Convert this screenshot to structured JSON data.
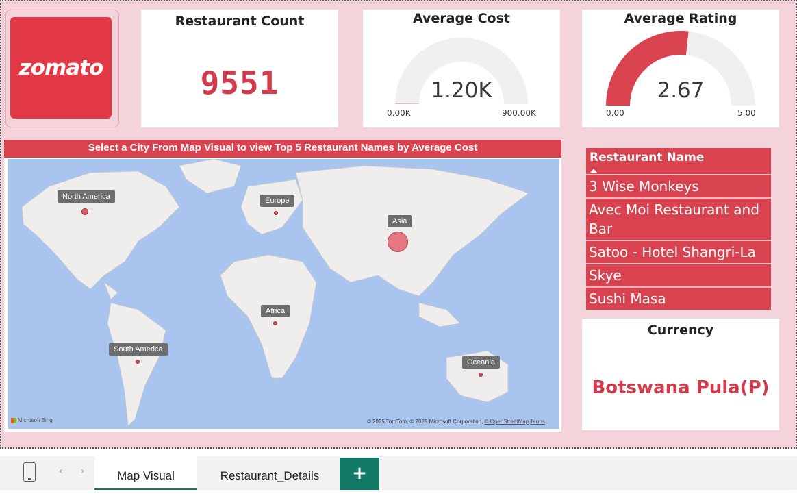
{
  "brand": {
    "logo_text": "zomato",
    "accent": "#e23744"
  },
  "kpis": {
    "restaurant_count": {
      "title": "Restaurant Count",
      "value": "9551"
    },
    "average_cost": {
      "title": "Average Cost",
      "value": "1.20K",
      "min_label": "0.00K",
      "max_label": "900.00K",
      "fill_fraction": 0.0013
    },
    "average_rating": {
      "title": "Average Rating",
      "value": "2.67",
      "min_label": "0.00",
      "max_label": "5.00",
      "fill_fraction": 0.534
    }
  },
  "map": {
    "title": "Select a City From Map Visual to view Top 5 Restaurant Names by Average Cost",
    "regions": [
      {
        "name": "North America"
      },
      {
        "name": "Europe"
      },
      {
        "name": "Asia"
      },
      {
        "name": "Africa"
      },
      {
        "name": "South America"
      },
      {
        "name": "Oceania"
      }
    ],
    "bing": "Microsoft Bing",
    "credit_prefix": "© 2025 TomTom, © 2025 Microsoft Corporation, ",
    "credit_osm": "© OpenStreetMap",
    "credit_terms": "Terms"
  },
  "restaurant_table": {
    "header": "Restaurant Name",
    "rows": [
      "3 Wise Monkeys",
      "Avec Moi Restaurant and Bar",
      "Satoo - Hotel Shangri-La",
      "Skye",
      "Sushi Masa"
    ]
  },
  "currency": {
    "title": "Currency",
    "value": "Botswana Pula(P)"
  },
  "tabs": {
    "active": "Map Visual",
    "items": [
      "Map Visual",
      "Restaurant_Details"
    ],
    "add_label": "+"
  }
}
